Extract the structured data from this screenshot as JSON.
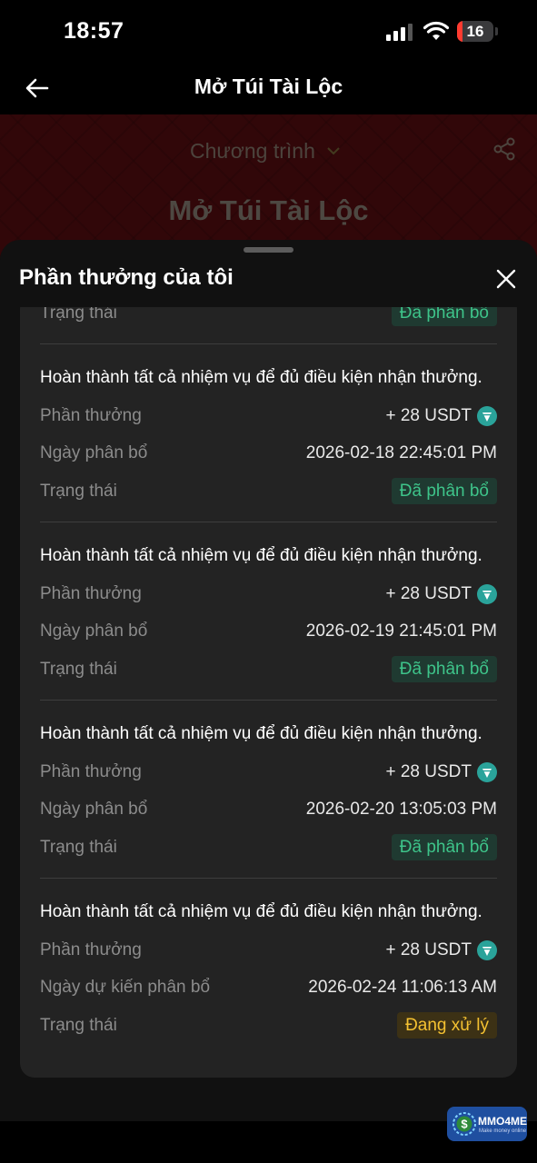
{
  "status_bar": {
    "time": "18:57",
    "battery": "16",
    "battery_level": 0.16
  },
  "nav": {
    "title": "Mở Túi Tài Lộc"
  },
  "banner": {
    "program_label": "Chương trình",
    "title": "Mở Túi Tài Lộc"
  },
  "sheet": {
    "title": "Phần thưởng của tôi",
    "partial_row": {
      "label": "Trạng thái",
      "status": "Đã phân bổ"
    },
    "items": [
      {
        "title": "Hoàn thành tất cả nhiệm vụ để đủ điều kiện nhận thưởng.",
        "reward_label": "Phần thưởng",
        "reward": "+ 28 USDT",
        "date_label": "Ngày phân bổ",
        "date": "2026-02-18 22:45:01 PM",
        "status_label": "Trạng thái",
        "status": "Đã phân bổ"
      },
      {
        "title": "Hoàn thành tất cả nhiệm vụ để đủ điều kiện nhận thưởng.",
        "reward_label": "Phần thưởng",
        "reward": "+ 28 USDT",
        "date_label": "Ngày phân bổ",
        "date": "2026-02-19 21:45:01 PM",
        "status_label": "Trạng thái",
        "status": "Đã phân bổ"
      },
      {
        "title": "Hoàn thành tất cả nhiệm vụ để đủ điều kiện nhận thưởng.",
        "reward_label": "Phần thưởng",
        "reward": "+ 28 USDT",
        "date_label": "Ngày phân bổ",
        "date": "2026-02-20 13:05:03 PM",
        "status_label": "Trạng thái",
        "status": "Đã phân bổ"
      },
      {
        "title": "Hoàn thành tất cả nhiệm vụ để đủ điều kiện nhận thưởng.",
        "reward_label": "Phần thưởng",
        "reward": "+ 28 USDT",
        "date_label": "Ngày dự kiến phân bổ",
        "date": "2026-02-24 11:06:13 AM",
        "status_label": "Trạng thái",
        "status": "Đang xử lý"
      }
    ]
  },
  "watermark": {
    "name": "MMO4ME",
    "tagline": "Make money online"
  },
  "colors": {
    "status_done": "#3ec48a",
    "status_pending": "#f4c131",
    "usdt": "#2aa39a"
  }
}
